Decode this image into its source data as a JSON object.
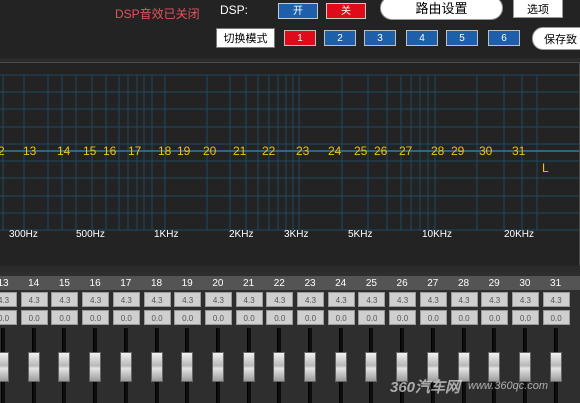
{
  "header": {
    "dsp_status": "DSP音效已关闭",
    "dsp_label": "DSP:",
    "on_label": "开",
    "off_label": "关",
    "routing_label": "路由设置",
    "options_label": "选项",
    "switch_mode_label": "切换模式",
    "save_label": "保存致",
    "presets": [
      "1",
      "2",
      "3",
      "4",
      "5",
      "6"
    ],
    "colors": {
      "on": "#1d5fa8",
      "off": "#e00b18",
      "preset_active": "#e00b18",
      "preset": "#1d5fa8"
    }
  },
  "graph": {
    "band_numbers": [
      "2",
      "13",
      "14",
      "15",
      "16",
      "17",
      "18",
      "19",
      "20",
      "21",
      "22",
      "23",
      "24",
      "25",
      "26",
      "27",
      "28",
      "29",
      "30",
      "31"
    ],
    "channel": "L",
    "freq_labels": [
      "300Hz",
      "500Hz",
      "1KHz",
      "2KHz",
      "3KHz",
      "5KHz",
      "10KHz",
      "20KHz"
    ],
    "colors": {
      "grid": "#1d4a62",
      "curve": "#2a7fa6",
      "label": "#f3c200"
    }
  },
  "bands": {
    "labels": [
      "13",
      "14",
      "15",
      "16",
      "17",
      "18",
      "19",
      "20",
      "21",
      "22",
      "23",
      "24",
      "25",
      "26",
      "27",
      "28",
      "29",
      "30",
      "31"
    ],
    "q_values": [
      "4.3",
      "4.3",
      "4.3",
      "4.3",
      "4.3",
      "4.3",
      "4.3",
      "4.3",
      "4.3",
      "4.3",
      "4.3",
      "4.3",
      "4.3",
      "4.3",
      "4.3",
      "4.3",
      "4.3",
      "4.3",
      "4.3"
    ],
    "gain_values": [
      "0.0",
      "0.0",
      "0.0",
      "0.0",
      "0.0",
      "0.0",
      "0.0",
      "0.0",
      "0.0",
      "0.0",
      "0.0",
      "0.0",
      "0.0",
      "0.0",
      "0.0",
      "0.0",
      "0.0",
      "0.0",
      "0.0"
    ]
  },
  "watermark": {
    "brand": "360汽车网",
    "url": "www.360qc.com"
  }
}
